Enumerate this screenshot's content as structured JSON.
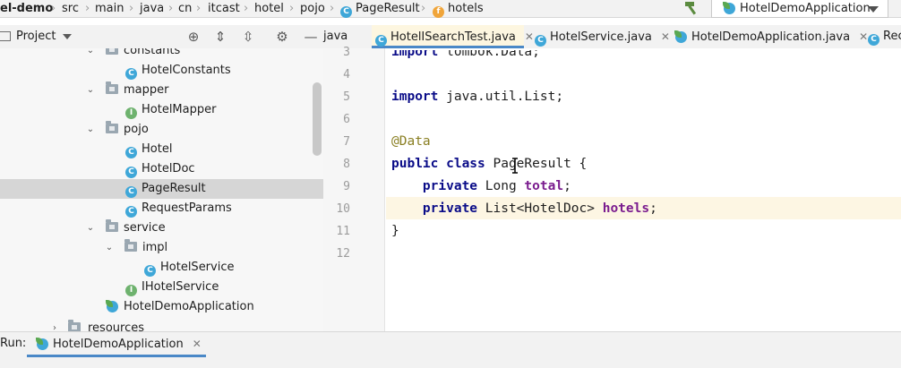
{
  "breadcrumb": {
    "items": [
      "el-demo",
      "src",
      "main",
      "java",
      "cn",
      "itcast",
      "hotel",
      "pojo",
      "PageResult",
      "hotels"
    ]
  },
  "run_config": {
    "label": "HotelDemoApplication"
  },
  "project_panel": {
    "title": "Project"
  },
  "editor_tabs": [
    {
      "label": "java"
    },
    {
      "label": "HotelISearchTest.java"
    },
    {
      "label": "HotelService.java"
    },
    {
      "label": "HotelDemoApplication.java"
    },
    {
      "label": "Rec"
    }
  ],
  "tree": {
    "rows": [
      {
        "label": "constants"
      },
      {
        "label": "HotelConstants"
      },
      {
        "label": "mapper"
      },
      {
        "label": "HotelMapper"
      },
      {
        "label": "pojo"
      },
      {
        "label": "Hotel"
      },
      {
        "label": "HotelDoc"
      },
      {
        "label": "PageResult"
      },
      {
        "label": "RequestParams"
      },
      {
        "label": "service"
      },
      {
        "label": "impl"
      },
      {
        "label": "HotelService"
      },
      {
        "label": "IHotelService"
      },
      {
        "label": "HotelDemoApplication"
      },
      {
        "label": "resources"
      }
    ]
  },
  "code": {
    "line_numbers": [
      "3",
      "4",
      "5",
      "6",
      "7",
      "8",
      "9",
      "10",
      "11",
      "12"
    ],
    "lines": {
      "l3": {
        "kw": "import",
        "rest": " lombok.Data;"
      },
      "l5": {
        "kw": "import",
        "rest": " java.util.List;"
      },
      "l7": {
        "ann": "@Data"
      },
      "l8": {
        "kw": "public class",
        "rest": " PageResult {"
      },
      "l9": {
        "kw": "private",
        "type": " Long ",
        "field": "total",
        "end": ";"
      },
      "l10": {
        "kw": "private",
        "type": " List<HotelDoc> ",
        "field": "hotels",
        "end": ";"
      },
      "l11": {
        "text": "}"
      }
    }
  },
  "run_bar": {
    "label": "Run:",
    "tab": "HotelDemoApplication"
  },
  "colors": {
    "accent": "#4a88c7",
    "keyword": "#0a0c88",
    "annotation": "#8a7f23",
    "field": "#7b1d8f",
    "caret_line": "#fdf6e3",
    "class_icon": "#3fa7d8",
    "interface_icon": "#6eb26e",
    "field_icon": "#f0a53a"
  }
}
